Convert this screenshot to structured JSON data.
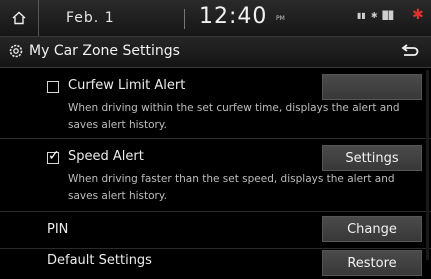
{
  "status_bar": {
    "date": "Feb. 1",
    "time": "12:40",
    "ampm": "PM",
    "icons": [
      "media-icon",
      "bluetooth-icon",
      "signal-icon"
    ]
  },
  "title_bar": {
    "title": "My Car Zone Settings"
  },
  "rows": {
    "curfew": {
      "label": "Curfew Limit Alert",
      "checked": false,
      "button": "",
      "description": "When driving within the set curfew time, displays the alert and saves alert history."
    },
    "speed": {
      "label": "Speed Alert",
      "checked": true,
      "button": "Settings",
      "description": "When driving faster than the set speed, displays the alert and saves alert history."
    },
    "pin": {
      "label": "PIN",
      "button": "Change"
    },
    "default": {
      "label": "Default Settings",
      "button": "Restore"
    }
  },
  "colors": {
    "background": "#000000",
    "button": "#404040",
    "indicator": "#e03030"
  }
}
